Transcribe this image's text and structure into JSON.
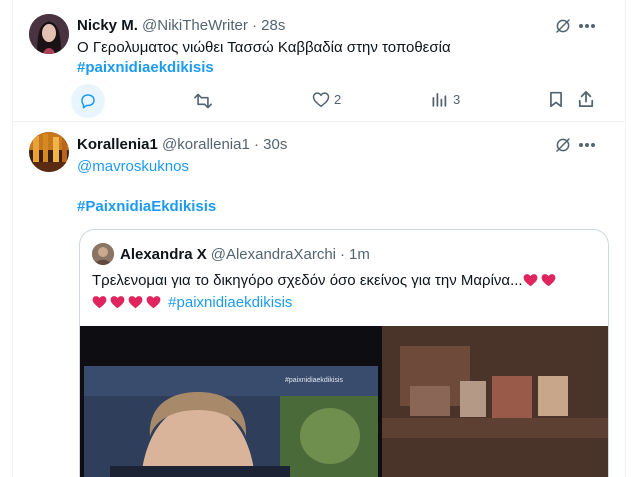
{
  "tweets": [
    {
      "name": "Nicky M.",
      "handle": "@NikiTheWriter",
      "dot": "·",
      "time": "28s",
      "text": "Ο Γερολυματος νιώθει Τασσώ Καββαδία στην τοποθεσία",
      "hashtag": "#paixnidiaekdikisis",
      "stats": {
        "replies": "",
        "retweets": "",
        "likes": "2",
        "views": "3"
      }
    },
    {
      "name": "Korallenia1",
      "handle": "@korallenia1",
      "dot": "·",
      "time": "30s",
      "mention": "@mavroskuknos",
      "hashtag": "#PaixnidiaEkdikisis",
      "quote": {
        "name": "Alexandra X",
        "handle": "@AlexandraXarchi",
        "dot": "·",
        "time": "1m",
        "text": "Τρελενομαι για το δικηγόρο σχεδόν όσο εκείνος για την Μαρίνα...",
        "hashtag": "#paixnidiaekdikisis",
        "tv_overlay": "#paixnidiaekdikisis"
      }
    }
  ],
  "colors": {
    "accent": "#1d9bf0",
    "muted": "#536471",
    "heart": "#e0245e"
  },
  "icons": [
    "grok-icon",
    "more-icon",
    "reply-icon",
    "retweet-icon",
    "like-icon",
    "views-icon",
    "bookmark-icon",
    "share-icon",
    "heart-emoji-icon"
  ]
}
